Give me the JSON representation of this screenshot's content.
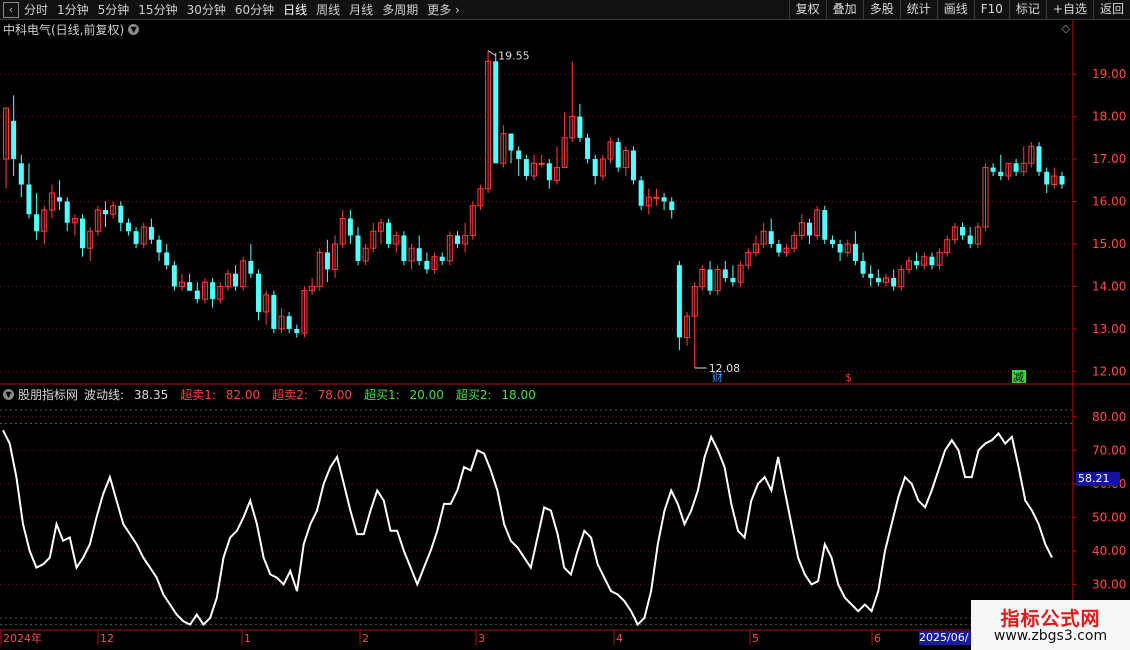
{
  "toolbar": {
    "tabs": [
      "分时",
      "1分钟",
      "5分钟",
      "15分钟",
      "30分钟",
      "60分钟",
      "日线",
      "周线",
      "月线",
      "多周期",
      "更多"
    ],
    "active_tab": "日线",
    "right_buttons": [
      "复权",
      "叠加",
      "多股",
      "统计",
      "画线",
      "F10",
      "标记",
      "+自选",
      "返回"
    ]
  },
  "main_chart": {
    "title": "中科电气(日线,前复权)",
    "price_axis": [
      "19.00",
      "18.00",
      "17.00",
      "16.00",
      "15.00",
      "14.00",
      "13.00",
      "12.00"
    ],
    "high_label": "19.55",
    "low_label": "12.08",
    "event_markers": [
      "财",
      "$",
      "减"
    ]
  },
  "indicator": {
    "name": "股朋指标网",
    "line_label": "波动线:",
    "line_value": "38.35",
    "sell1_label": "超卖1:",
    "sell1_value": "82.00",
    "sell2_label": "超卖2:",
    "sell2_value": "78.00",
    "buy1_label": "超买1:",
    "buy1_value": "20.00",
    "buy2_label": "超买2:",
    "buy2_value": "18.00",
    "axis": [
      "80.00",
      "70.00",
      "60.00",
      "50.00",
      "40.00",
      "30.00"
    ],
    "pointer_value": "58.21"
  },
  "time_axis": {
    "labels": [
      "2024年",
      "12",
      "1",
      "2",
      "3",
      "4",
      "5",
      "6"
    ],
    "current_date": "2025/06/"
  },
  "watermark": {
    "line1": "指标公式网",
    "line2": "www.zbgs3.com"
  },
  "colors": {
    "up": "#ff3c3c",
    "down": "#54ffff",
    "grid": "#7a1010",
    "osc": "#ffffff"
  },
  "chart_data": {
    "type": "candlestick",
    "price_range": [
      11.75,
      19.85
    ],
    "candles_ohlc": [
      [
        17.0,
        18.2,
        16.3,
        18.2
      ],
      [
        17.9,
        18.5,
        16.6,
        17.0
      ],
      [
        16.9,
        17.1,
        16.1,
        16.4
      ],
      [
        16.4,
        16.9,
        15.6,
        15.7
      ],
      [
        15.7,
        16.2,
        15.1,
        15.3
      ],
      [
        15.3,
        15.9,
        15.0,
        15.8
      ],
      [
        15.8,
        16.4,
        15.6,
        16.2
      ],
      [
        16.1,
        16.5,
        15.8,
        16.0
      ],
      [
        16.0,
        16.1,
        15.3,
        15.5
      ],
      [
        15.5,
        15.7,
        15.2,
        15.6
      ],
      [
        15.6,
        15.7,
        14.7,
        14.9
      ],
      [
        14.9,
        15.4,
        14.6,
        15.3
      ],
      [
        15.3,
        15.9,
        15.2,
        15.8
      ],
      [
        15.8,
        16.0,
        15.4,
        15.7
      ],
      [
        15.7,
        16.0,
        15.6,
        15.9
      ],
      [
        15.9,
        16.0,
        15.3,
        15.5
      ],
      [
        15.5,
        15.6,
        15.2,
        15.3
      ],
      [
        15.3,
        15.4,
        14.9,
        15.0
      ],
      [
        15.0,
        15.5,
        14.9,
        15.4
      ],
      [
        15.4,
        15.6,
        15.0,
        15.1
      ],
      [
        15.1,
        15.2,
        14.6,
        14.8
      ],
      [
        14.8,
        15.0,
        14.4,
        14.5
      ],
      [
        14.5,
        14.6,
        13.9,
        14.0
      ],
      [
        14.0,
        14.3,
        13.9,
        14.1
      ],
      [
        14.1,
        14.3,
        13.9,
        13.9
      ],
      [
        13.9,
        14.1,
        13.6,
        13.7
      ],
      [
        13.7,
        14.2,
        13.6,
        14.1
      ],
      [
        14.1,
        14.2,
        13.5,
        13.7
      ],
      [
        13.7,
        14.1,
        13.6,
        14.0
      ],
      [
        14.0,
        14.4,
        13.9,
        14.3
      ],
      [
        14.3,
        14.5,
        13.9,
        14.0
      ],
      [
        14.0,
        14.7,
        13.9,
        14.6
      ],
      [
        14.6,
        15.0,
        14.2,
        14.3
      ],
      [
        14.3,
        14.4,
        13.2,
        13.4
      ],
      [
        13.4,
        13.9,
        13.1,
        13.8
      ],
      [
        13.8,
        13.9,
        12.9,
        13.0
      ],
      [
        13.0,
        13.5,
        12.9,
        13.3
      ],
      [
        13.3,
        13.4,
        12.9,
        13.0
      ],
      [
        13.0,
        13.1,
        12.8,
        12.9
      ],
      [
        12.9,
        14.0,
        12.8,
        13.9
      ],
      [
        13.9,
        14.2,
        13.8,
        14.0
      ],
      [
        14.0,
        14.9,
        13.9,
        14.8
      ],
      [
        14.8,
        15.1,
        14.1,
        14.4
      ],
      [
        14.4,
        15.2,
        14.2,
        15.0
      ],
      [
        15.0,
        15.8,
        14.9,
        15.6
      ],
      [
        15.6,
        15.8,
        15.0,
        15.2
      ],
      [
        15.2,
        15.4,
        14.5,
        14.6
      ],
      [
        14.6,
        15.0,
        14.5,
        14.9
      ],
      [
        14.9,
        15.5,
        14.8,
        15.3
      ],
      [
        15.3,
        15.6,
        15.0,
        15.5
      ],
      [
        15.5,
        15.6,
        14.9,
        15.0
      ],
      [
        15.0,
        15.3,
        14.8,
        15.2
      ],
      [
        15.2,
        15.3,
        14.5,
        14.6
      ],
      [
        14.6,
        15.0,
        14.4,
        14.9
      ],
      [
        14.9,
        15.2,
        14.5,
        14.6
      ],
      [
        14.6,
        14.8,
        14.3,
        14.4
      ],
      [
        14.4,
        14.8,
        14.3,
        14.7
      ],
      [
        14.7,
        14.8,
        14.5,
        14.6
      ],
      [
        14.6,
        15.3,
        14.5,
        15.2
      ],
      [
        15.2,
        15.3,
        14.9,
        15.0
      ],
      [
        15.0,
        15.5,
        14.8,
        15.2
      ],
      [
        15.2,
        16.0,
        15.1,
        15.9
      ],
      [
        15.9,
        16.4,
        15.8,
        16.3
      ],
      [
        16.3,
        19.55,
        16.2,
        19.3
      ],
      [
        19.3,
        19.5,
        16.9,
        16.9
      ],
      [
        16.9,
        17.8,
        16.8,
        17.6
      ],
      [
        17.6,
        17.6,
        16.9,
        17.2
      ],
      [
        17.2,
        17.3,
        16.6,
        17.0
      ],
      [
        17.0,
        17.1,
        16.5,
        16.6
      ],
      [
        16.6,
        17.1,
        16.5,
        16.9
      ],
      [
        16.9,
        17.1,
        16.8,
        16.9
      ],
      [
        16.9,
        17.0,
        16.3,
        16.5
      ],
      [
        16.5,
        17.3,
        16.4,
        16.8
      ],
      [
        16.8,
        18.1,
        16.8,
        17.5
      ],
      [
        17.5,
        19.3,
        17.4,
        18.0
      ],
      [
        18.0,
        18.3,
        17.4,
        17.5
      ],
      [
        17.5,
        17.6,
        16.9,
        17.0
      ],
      [
        17.0,
        17.1,
        16.4,
        16.6
      ],
      [
        16.6,
        17.1,
        16.5,
        17.0
      ],
      [
        17.0,
        17.5,
        16.9,
        17.4
      ],
      [
        17.4,
        17.5,
        16.7,
        16.8
      ],
      [
        16.8,
        17.3,
        16.6,
        17.2
      ],
      [
        17.2,
        17.3,
        16.4,
        16.5
      ],
      [
        16.5,
        16.6,
        15.8,
        15.9
      ],
      [
        15.9,
        16.3,
        15.7,
        16.1
      ],
      [
        16.1,
        16.3,
        15.9,
        16.1
      ],
      [
        16.1,
        16.2,
        15.8,
        16.0
      ],
      [
        16.0,
        16.1,
        15.6,
        15.8
      ],
      [
        14.5,
        14.6,
        12.5,
        12.8
      ],
      [
        12.8,
        13.4,
        12.6,
        13.3
      ],
      [
        13.3,
        14.1,
        12.08,
        14.0
      ],
      [
        14.0,
        14.5,
        13.9,
        14.4
      ],
      [
        14.4,
        14.6,
        13.8,
        13.9
      ],
      [
        13.9,
        14.5,
        13.8,
        14.4
      ],
      [
        14.4,
        14.6,
        14.1,
        14.2
      ],
      [
        14.2,
        14.5,
        14.0,
        14.1
      ],
      [
        14.1,
        14.6,
        14.0,
        14.5
      ],
      [
        14.5,
        14.9,
        14.4,
        14.8
      ],
      [
        14.8,
        15.2,
        14.7,
        15.0
      ],
      [
        15.0,
        15.5,
        14.9,
        15.3
      ],
      [
        15.3,
        15.6,
        14.9,
        15.0
      ],
      [
        15.0,
        15.1,
        14.7,
        14.8
      ],
      [
        14.8,
        15.0,
        14.7,
        14.9
      ],
      [
        14.9,
        15.3,
        14.8,
        15.2
      ],
      [
        15.2,
        15.7,
        15.1,
        15.5
      ],
      [
        15.5,
        15.6,
        15.0,
        15.2
      ],
      [
        15.2,
        15.9,
        15.1,
        15.8
      ],
      [
        15.8,
        15.9,
        15.0,
        15.1
      ],
      [
        15.1,
        15.2,
        14.9,
        15.0
      ],
      [
        15.0,
        15.1,
        14.6,
        14.8
      ],
      [
        14.8,
        15.1,
        14.7,
        15.0
      ],
      [
        15.0,
        15.3,
        14.5,
        14.6
      ],
      [
        14.6,
        14.8,
        14.2,
        14.3
      ],
      [
        14.3,
        14.5,
        14.0,
        14.2
      ],
      [
        14.2,
        14.4,
        14.0,
        14.1
      ],
      [
        14.1,
        14.3,
        14.0,
        14.2
      ],
      [
        14.2,
        14.4,
        13.9,
        14.0
      ],
      [
        14.0,
        14.5,
        13.9,
        14.4
      ],
      [
        14.4,
        14.7,
        14.3,
        14.6
      ],
      [
        14.6,
        14.8,
        14.4,
        14.5
      ],
      [
        14.5,
        14.8,
        14.4,
        14.7
      ],
      [
        14.7,
        14.8,
        14.4,
        14.5
      ],
      [
        14.5,
        14.9,
        14.4,
        14.8
      ],
      [
        14.8,
        15.2,
        14.7,
        15.1
      ],
      [
        15.1,
        15.5,
        15.0,
        15.4
      ],
      [
        15.4,
        15.5,
        15.1,
        15.2
      ],
      [
        15.2,
        15.4,
        14.9,
        15.0
      ],
      [
        15.0,
        15.5,
        14.9,
        15.4
      ],
      [
        15.4,
        16.9,
        15.3,
        16.8
      ],
      [
        16.8,
        16.9,
        16.6,
        16.7
      ],
      [
        16.7,
        17.1,
        16.5,
        16.6
      ],
      [
        16.6,
        16.9,
        16.5,
        16.9
      ],
      [
        16.9,
        17.0,
        16.6,
        16.7
      ],
      [
        16.7,
        17.3,
        16.6,
        16.9
      ],
      [
        16.9,
        17.4,
        16.8,
        17.3
      ],
      [
        17.3,
        17.4,
        16.6,
        16.7
      ],
      [
        16.7,
        16.8,
        16.2,
        16.4
      ],
      [
        16.4,
        16.8,
        16.3,
        16.6
      ],
      [
        16.6,
        16.7,
        16.3,
        16.4
      ]
    ],
    "indicator_series": {
      "name": "波动线",
      "value_range": [
        17,
        85
      ],
      "values": [
        76,
        72,
        62,
        48,
        40,
        35,
        36,
        38,
        48,
        43,
        44,
        35,
        38,
        42,
        50,
        57,
        62,
        55,
        48,
        45,
        42,
        38,
        35,
        32,
        27,
        24,
        21,
        19,
        18,
        21,
        18,
        20,
        26,
        38,
        44,
        46,
        50,
        55,
        48,
        38,
        33,
        32,
        30,
        34,
        28,
        42,
        48,
        52,
        60,
        65,
        68,
        60,
        52,
        45,
        45,
        52,
        58,
        55,
        46,
        46,
        40,
        35,
        30,
        35,
        40,
        46,
        54,
        54,
        58,
        65,
        64,
        70,
        69,
        64,
        58,
        48,
        43,
        41,
        38,
        35,
        44,
        53,
        52,
        45,
        35,
        33,
        40,
        46,
        44,
        36,
        32,
        28,
        27,
        25,
        22,
        18,
        20,
        28,
        42,
        52,
        58,
        54,
        48,
        52,
        58,
        68,
        74,
        70,
        65,
        54,
        46,
        44,
        55,
        60,
        62,
        58,
        68,
        58,
        48,
        38,
        33,
        30,
        31,
        42,
        38,
        30,
        26,
        24,
        22,
        24,
        22,
        28,
        40,
        48,
        56,
        62,
        60,
        55,
        53,
        58,
        64,
        70,
        73,
        70,
        62,
        62,
        70,
        72,
        73,
        75,
        72,
        74,
        65,
        55,
        52,
        48,
        42,
        38
      ],
      "overbought": [
        82,
        78
      ],
      "oversold": [
        20,
        18
      ]
    }
  }
}
